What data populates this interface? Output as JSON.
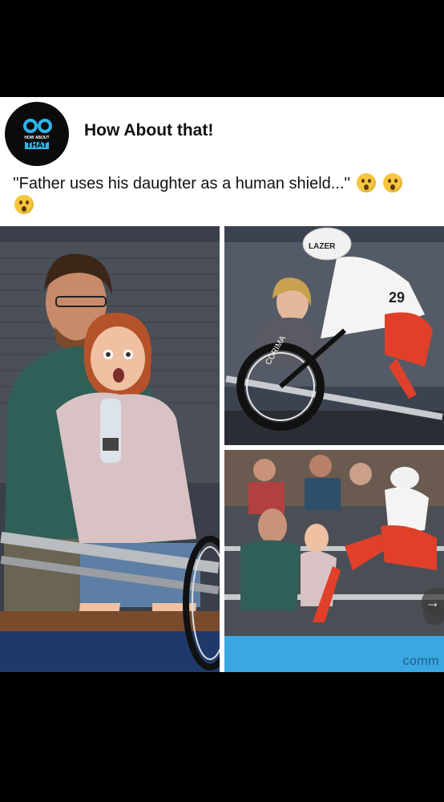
{
  "post": {
    "page_name": "How About that!",
    "avatar": {
      "logo_top_text": "HOW ABOUT",
      "logo_main_text": "THAT",
      "icon": "film-camera-icon"
    },
    "caption_text": "''Father uses his daughter as a human shield...''",
    "caption_emojis": [
      "astonished-face-emoji",
      "astonished-face-emoji",
      "astonished-face-emoji"
    ],
    "photos": [
      {
        "description_name": "photo-father-daughter"
      },
      {
        "description_name": "photo-cyclist-crash",
        "helmet_text": "LAZER",
        "bib_number": "29",
        "wheel_text": "CORIMA"
      },
      {
        "description_name": "photo-cyclist-stands",
        "watermark_text": "comm"
      }
    ],
    "next_arrow": "→"
  },
  "colors": {
    "background": "#000000",
    "post_background": "#ffffff",
    "brand_accent": "#2fb4e8",
    "emoji": "#f7c63c",
    "cyclist_red": "#e0402a",
    "track_blue": "#3aa7e0"
  }
}
